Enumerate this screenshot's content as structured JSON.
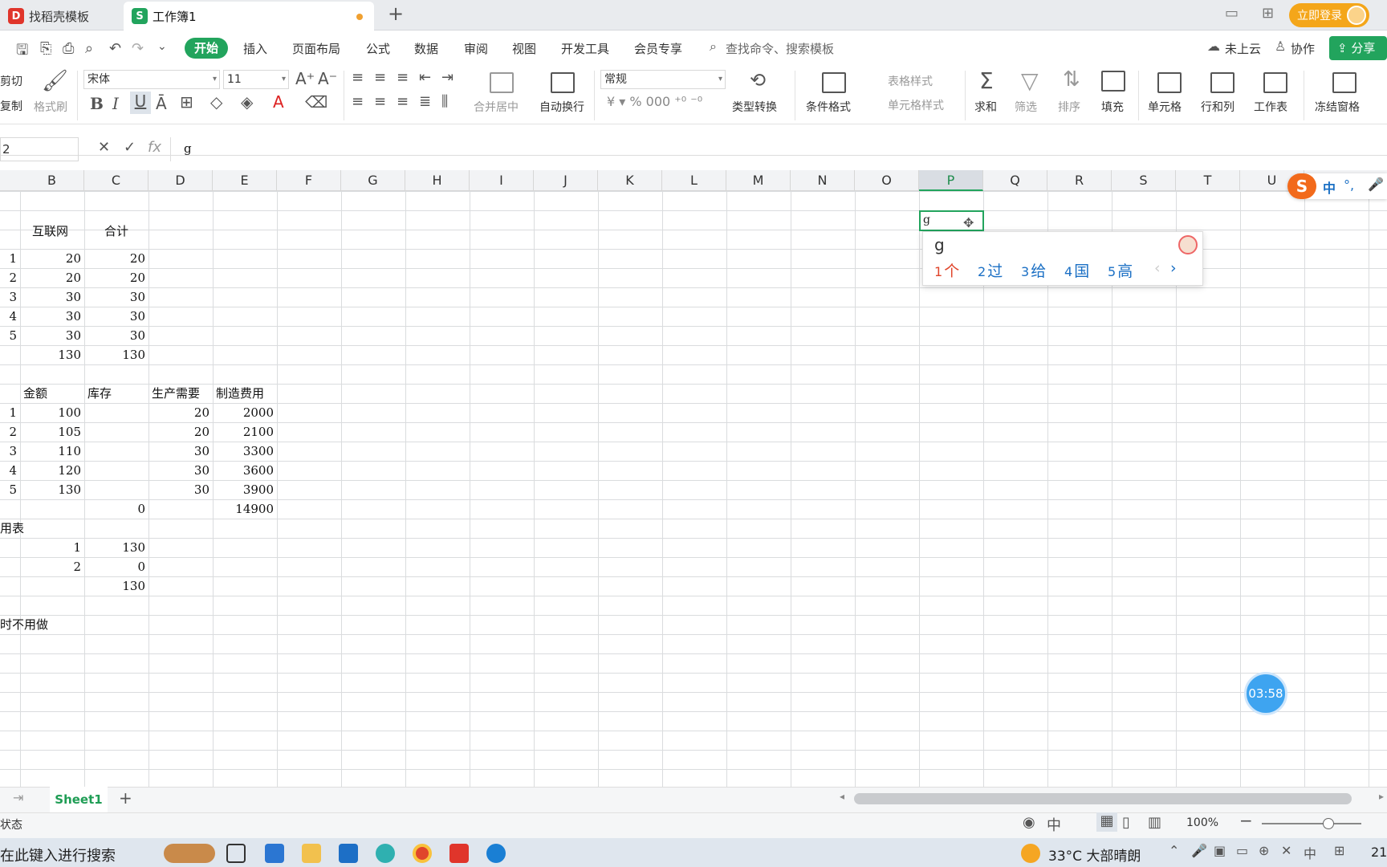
{
  "tabs": {
    "inactive": "找稻壳模板",
    "active": "工作簿1"
  },
  "login_label": "立即登录",
  "menu": {
    "start": "开始",
    "items": [
      "插入",
      "页面布局",
      "公式",
      "数据",
      "审阅",
      "视图",
      "开发工具",
      "会员专享"
    ],
    "search": "查找命令、搜索模板",
    "cloud": "未上云",
    "collab": "协作",
    "share": "分享"
  },
  "ribbon": {
    "cut": "剪切",
    "copy": "复制",
    "format_painter": "格式刷",
    "font": "宋体",
    "size": "11",
    "bold": "B",
    "italic": "I",
    "underline": "U",
    "merge": "合并居中",
    "wrap": "自动换行",
    "num_format": "常规",
    "type_convert": "类型转换",
    "cond_format": "条件格式",
    "table_style": "表格样式",
    "cell_style": "单元格样式",
    "sum": "求和",
    "filter": "筛选",
    "sort": "排序",
    "fill": "填充",
    "cell": "单元格",
    "rowcol": "行和列",
    "sheet": "工作表",
    "freeze": "冻结窗格"
  },
  "namebox": "2",
  "formula": "g",
  "columns": [
    "B",
    "C",
    "D",
    "E",
    "F",
    "G",
    "H",
    "I",
    "J",
    "K",
    "L",
    "M",
    "N",
    "O",
    "P",
    "Q",
    "R",
    "S",
    "T",
    "U"
  ],
  "cells": {
    "r1": [
      "互联网",
      "合计"
    ],
    "table1": [
      [
        "1",
        "20",
        "20"
      ],
      [
        "2",
        "20",
        "20"
      ],
      [
        "3",
        "30",
        "30"
      ],
      [
        "4",
        "30",
        "30"
      ],
      [
        "5",
        "30",
        "30"
      ],
      [
        "",
        "130",
        "130"
      ]
    ],
    "header2": [
      "金额",
      "库存",
      "生产需要",
      "制造费用"
    ],
    "table2": [
      [
        "1",
        "100",
        "",
        "20",
        "2000"
      ],
      [
        "2",
        "105",
        "",
        "20",
        "2100"
      ],
      [
        "3",
        "110",
        "",
        "30",
        "3300"
      ],
      [
        "4",
        "120",
        "",
        "30",
        "3600"
      ],
      [
        "5",
        "130",
        "",
        "30",
        "3900"
      ],
      [
        "",
        "",
        "0",
        "",
        "14900"
      ]
    ],
    "label_a": "用表",
    "table3": [
      [
        "1",
        "130"
      ],
      [
        "2",
        "0"
      ],
      [
        "",
        "130"
      ]
    ],
    "label_b": "时不用做",
    "active_cell": "g"
  },
  "ime": {
    "input": "g",
    "candidates": [
      {
        "n": "1",
        "c": "个"
      },
      {
        "n": "2",
        "c": "过"
      },
      {
        "n": "3",
        "c": "给"
      },
      {
        "n": "4",
        "c": "国"
      },
      {
        "n": "5",
        "c": "高"
      }
    ]
  },
  "sogou": {
    "mode": "中",
    "punct": "°,"
  },
  "timer": "03:58",
  "sheet_tab": "Sheet1",
  "status": {
    "left": "状态",
    "zoom": "100%"
  },
  "taskbar": {
    "search": "在此键入进行搜索",
    "weather": "33°C 大部晴朗",
    "clock": "21"
  }
}
